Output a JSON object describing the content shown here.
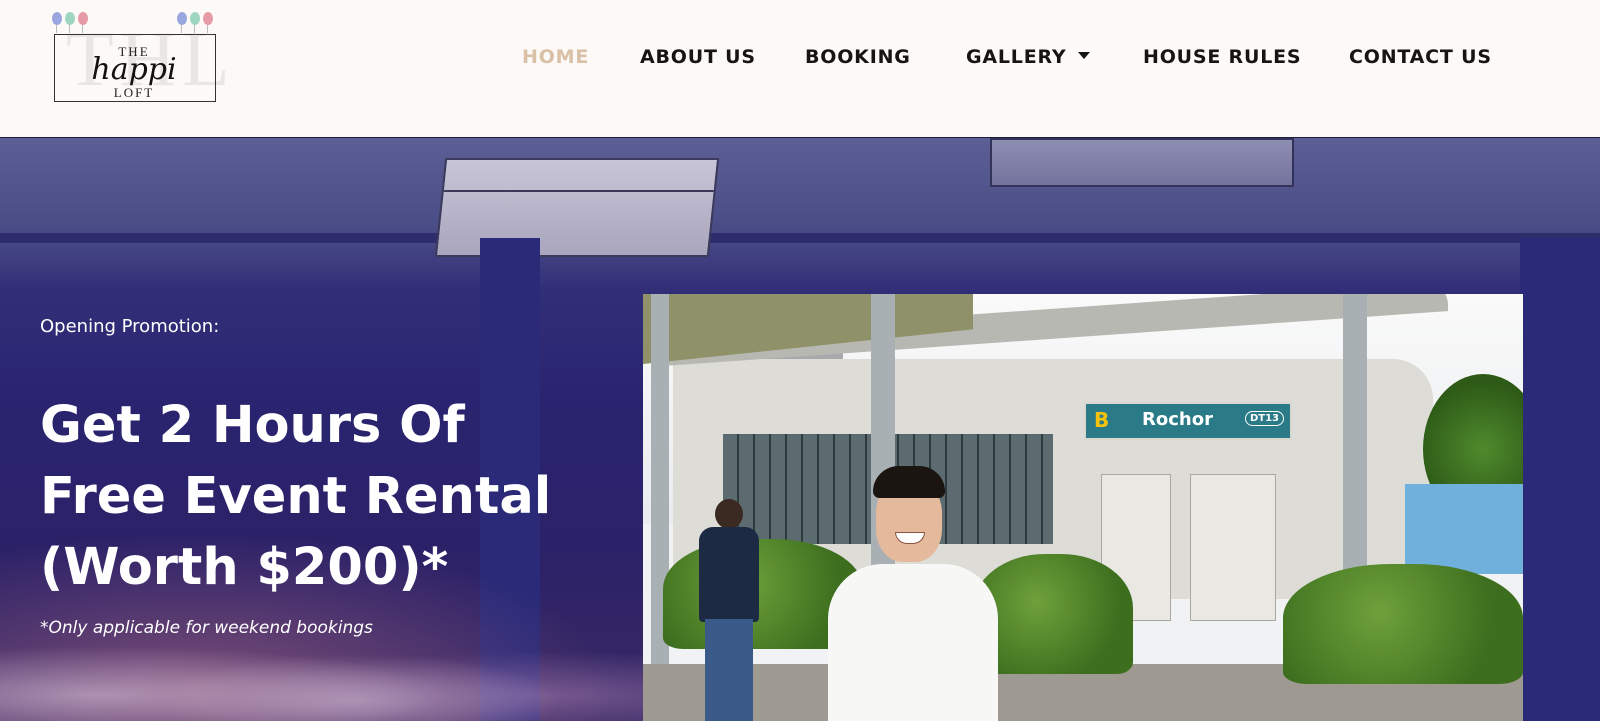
{
  "logo": {
    "line1": "THE",
    "line2": "happi",
    "line3": "LOFT",
    "ghost": "THL",
    "balloon_colors": [
      "#9aa6e0",
      "#9fd6c2",
      "#e59aa6"
    ]
  },
  "nav": {
    "home": "HOME",
    "about": "ABOUT US",
    "booking": "BOOKING",
    "gallery": "GALLERY",
    "house_rules": "HOUSE RULES",
    "contact": "CONTACT US",
    "active": "HOME",
    "active_color": "#d9c0a6"
  },
  "hero": {
    "promo_label": "Opening Promotion:",
    "promo_title_line1": "Get 2 Hours Of",
    "promo_title_line2": "Free Event Rental",
    "promo_title_line3": "(Worth $200)*",
    "promo_note": "*Only applicable for weekend bookings",
    "overlay_color": "#2b2168"
  },
  "photo": {
    "sign_letter": "B",
    "station_name": "Rochor",
    "station_code": "DT13"
  }
}
